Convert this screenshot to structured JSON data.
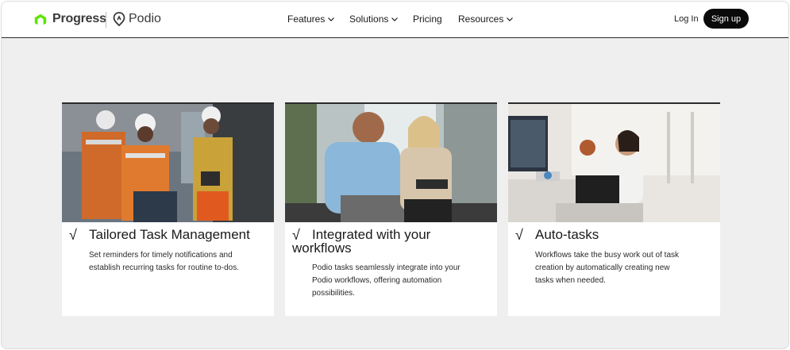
{
  "header": {
    "brand_progress": "Progress",
    "brand_podio": "Podio",
    "nav": [
      {
        "label": "Features",
        "has_dropdown": true
      },
      {
        "label": "Solutions",
        "has_dropdown": true
      },
      {
        "label": "Pricing",
        "has_dropdown": false
      },
      {
        "label": "Resources",
        "has_dropdown": true
      }
    ],
    "login_label": "Log In",
    "signup_label": "Sign up"
  },
  "cards": [
    {
      "check": "√",
      "title": "Tailored Task Management",
      "description": "Set reminders for timely notifications and establish recurring tasks for routine to-dos.",
      "image": "construction-workers-photo"
    },
    {
      "check": "√",
      "title_line1": "Integrated with your",
      "title_line2": "workflows",
      "description": "Podio tasks seamlessly integrate into your Podio workflows, offering automation possibilities.",
      "image": "business-meeting-photo"
    },
    {
      "check": "√",
      "title": "Auto-tasks",
      "description": "Workflows take the busy work out of task creation by automatically creating new tasks when needed.",
      "image": "video-call-office-photo"
    }
  ],
  "colors": {
    "brand_green": "#5ce500",
    "background": "#efefef",
    "signup_bg": "#0a0a0a"
  }
}
